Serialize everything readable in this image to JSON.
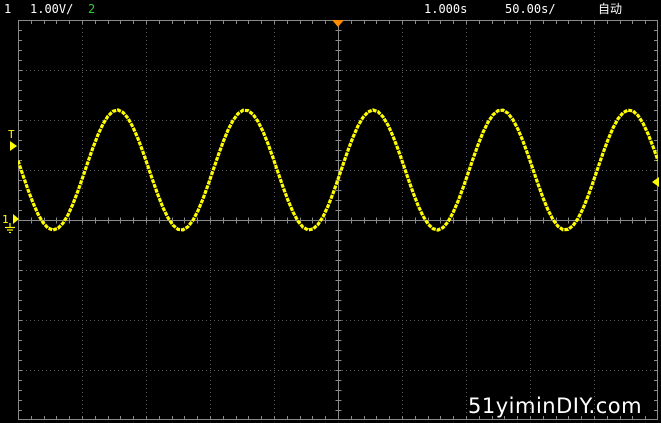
{
  "status": {
    "ch1_num": "1",
    "ch1_scale": "1.00V/",
    "ch2_num": "2",
    "time_pos": "1.000s",
    "time_scale": "50.00s/",
    "mode": "自动"
  },
  "colors": {
    "ch1": "#ffff00",
    "ch2": "#33cc33",
    "trigger": "#ff8c00",
    "grid": "#5a5a5a",
    "background": "#000000"
  },
  "markers": {
    "trigger_level": "T",
    "ch1_ground": "1",
    "ground_icon": "ground-icon"
  },
  "waveform": {
    "channel": "1",
    "shape": "sine",
    "cycles_visible": 5,
    "amplitude_divisions": 1.2,
    "offset_divisions": 1.0
  },
  "watermark": "51yiminDIY.com"
}
